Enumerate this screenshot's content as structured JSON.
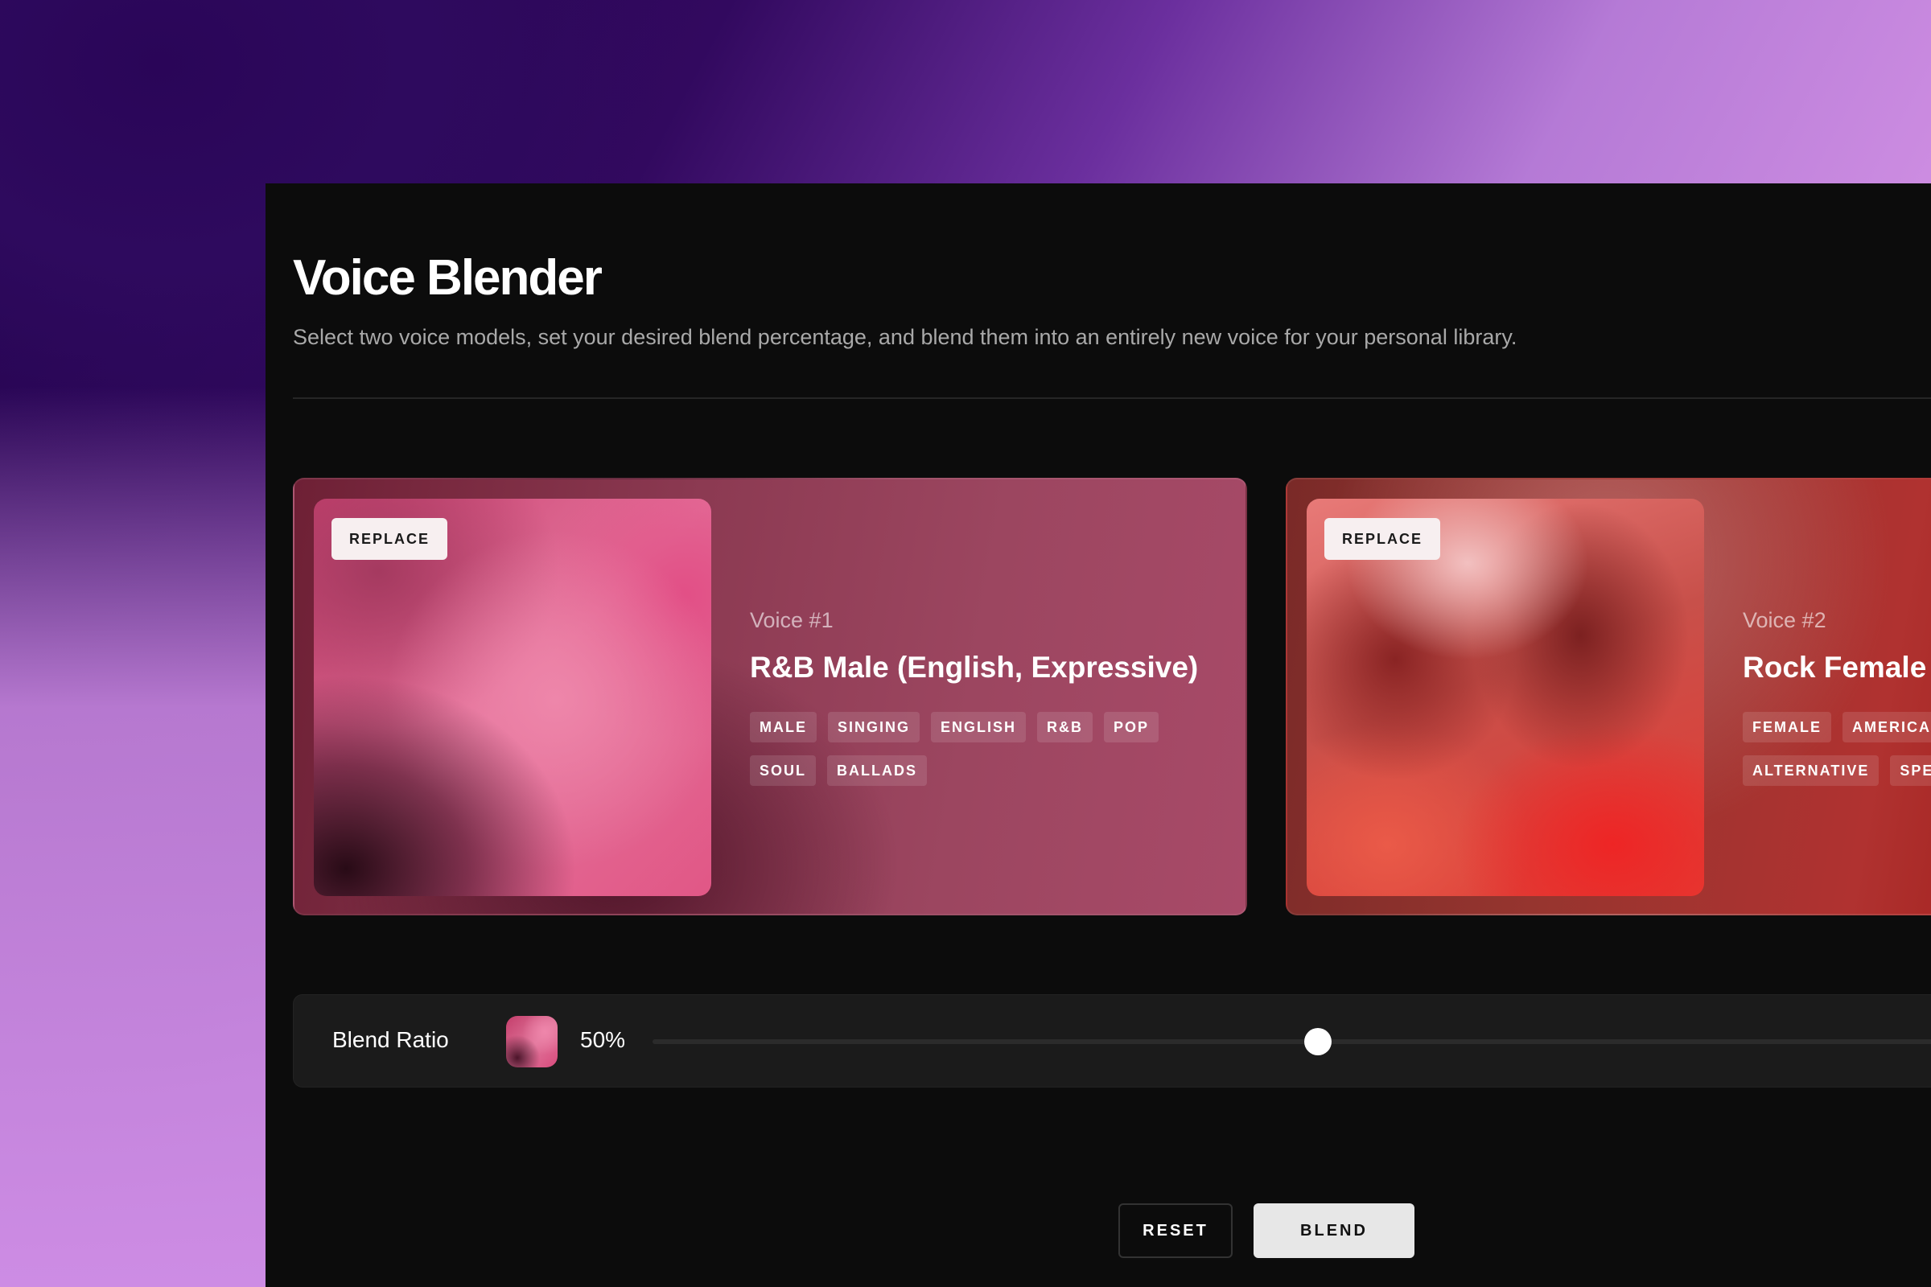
{
  "header": {
    "title": "Voice Blender",
    "subtitle": "Select two voice models, set your desired blend percentage, and blend them into an entirely new voice for your personal library."
  },
  "voices": [
    {
      "replace_label": "REPLACE",
      "number_label": "Voice #1",
      "name": "R&B Male (English, Expressive)",
      "tags": [
        "MALE",
        "SINGING",
        "ENGLISH",
        "R&B",
        "POP",
        "SOUL",
        "BALLADS"
      ]
    },
    {
      "replace_label": "REPLACE",
      "number_label": "Voice #2",
      "name": "Rock Female",
      "tags": [
        "FEMALE",
        "AMERICA",
        "ALTERNATIVE",
        "SPE"
      ]
    }
  ],
  "blend": {
    "label": "Blend Ratio",
    "value_text": "50%",
    "value": 50
  },
  "actions": {
    "reset_label": "RESET",
    "blend_label": "BLEND"
  },
  "colors": {
    "window_bg": "#0c0c0c",
    "card1_bg": "#9c4660",
    "card2_bg": "#b03230",
    "primary_button_bg": "#e7e7e7"
  }
}
